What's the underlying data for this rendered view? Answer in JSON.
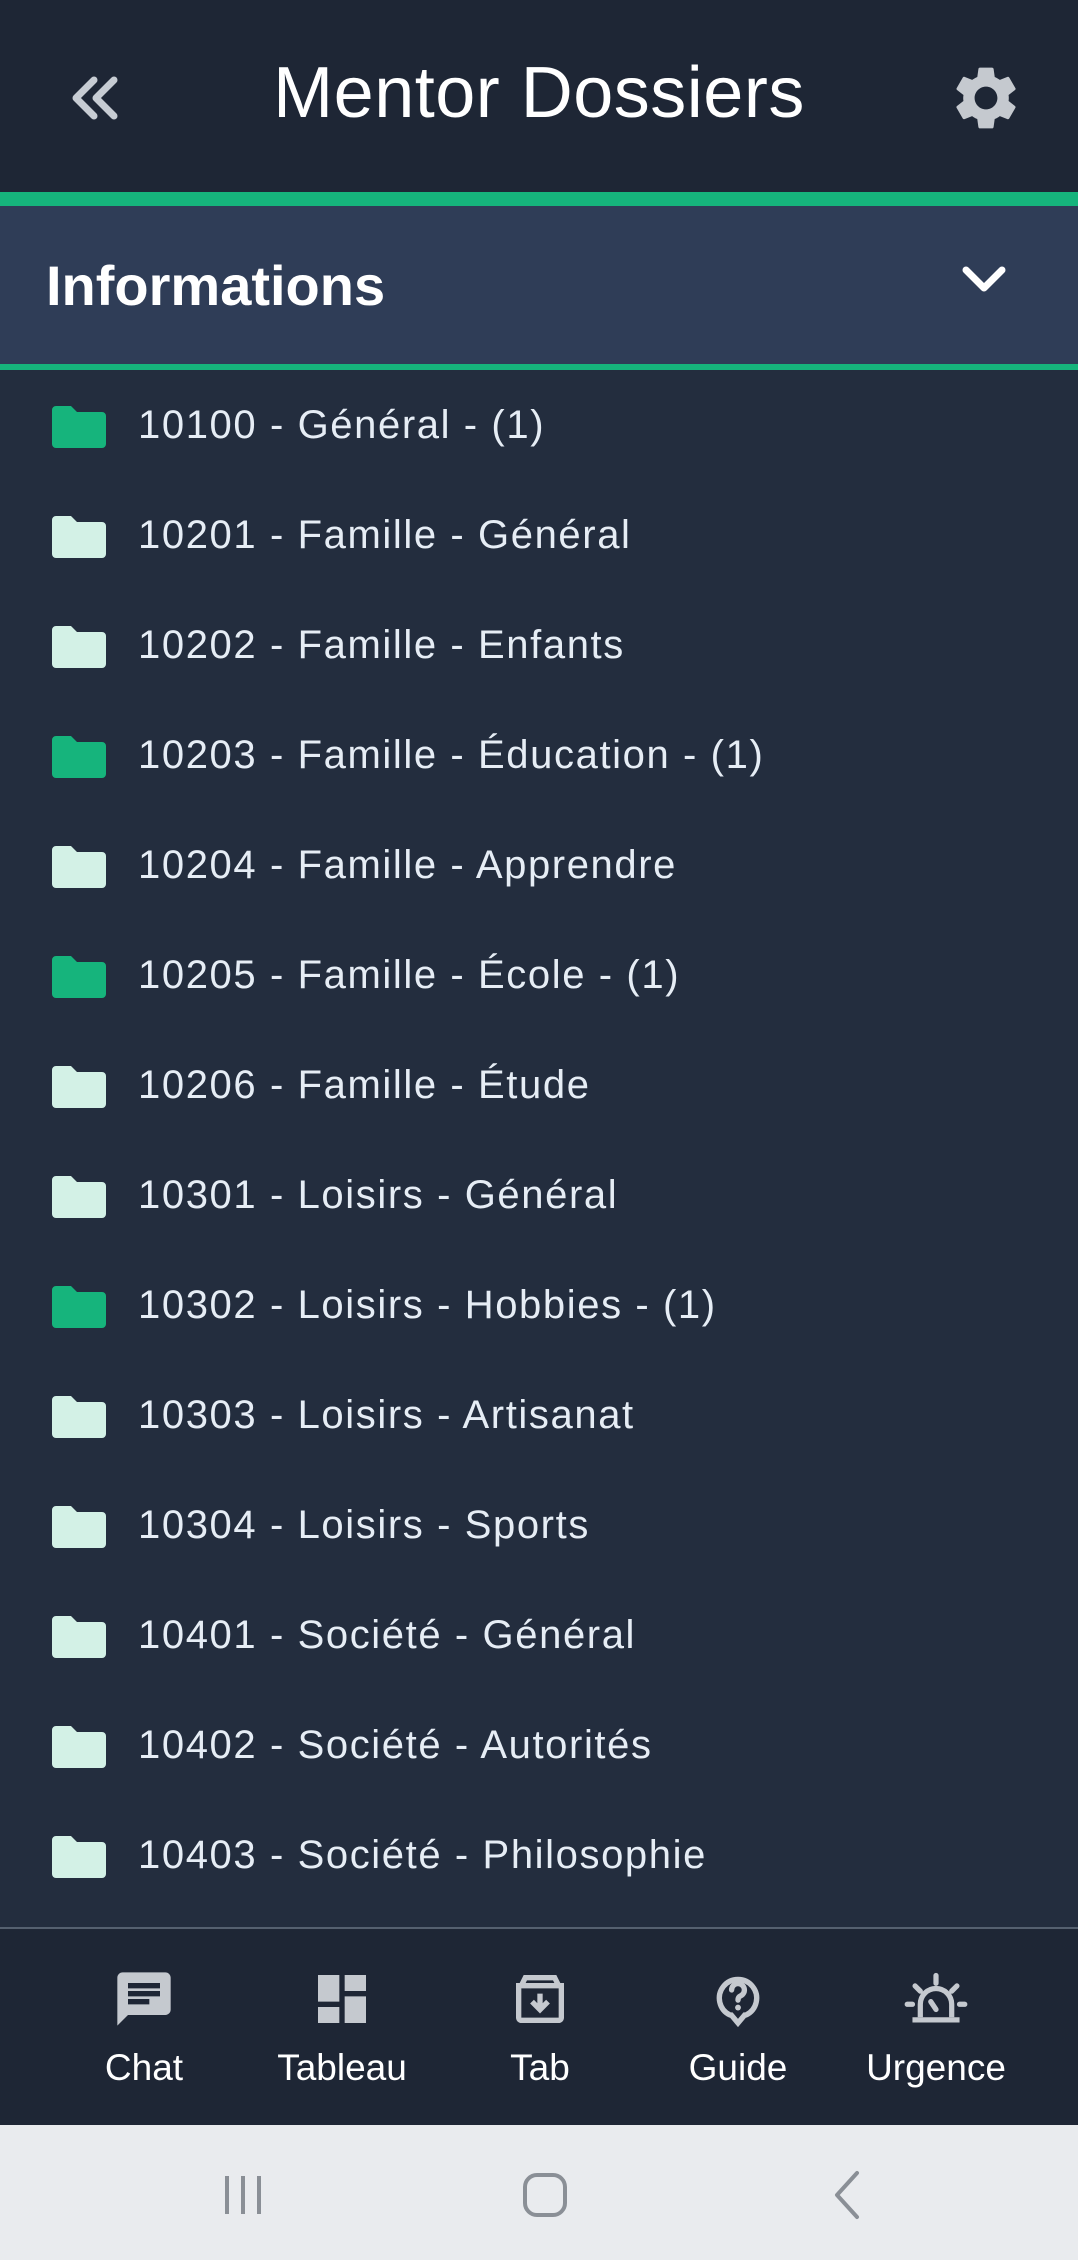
{
  "header": {
    "title": "Mentor Dossiers",
    "back_icon": "double-chevron-left-icon",
    "settings_icon": "gear-icon"
  },
  "section": {
    "title": "Informations",
    "toggle_icon": "chevron-down-icon",
    "expanded": true
  },
  "folders": [
    {
      "label": "10100 - Général - (1)",
      "has_items": true
    },
    {
      "label": "10201 - Famille - Général",
      "has_items": false
    },
    {
      "label": "10202 - Famille - Enfants",
      "has_items": false
    },
    {
      "label": "10203 - Famille - Éducation - (1)",
      "has_items": true
    },
    {
      "label": "10204 - Famille - Apprendre",
      "has_items": false
    },
    {
      "label": "10205 - Famille - École - (1)",
      "has_items": true
    },
    {
      "label": "10206 - Famille - Étude",
      "has_items": false
    },
    {
      "label": "10301 - Loisirs - Général",
      "has_items": false
    },
    {
      "label": "10302 - Loisirs - Hobbies - (1)",
      "has_items": true
    },
    {
      "label": "10303 - Loisirs - Artisanat",
      "has_items": false
    },
    {
      "label": "10304 - Loisirs - Sports",
      "has_items": false
    },
    {
      "label": "10401 - Société - Général",
      "has_items": false
    },
    {
      "label": "10402 - Société - Autorités",
      "has_items": false
    },
    {
      "label": "10403 - Société - Philosophie",
      "has_items": false
    }
  ],
  "tabs": [
    {
      "label": "Chat",
      "icon": "chat-icon"
    },
    {
      "label": "Tableau",
      "icon": "dashboard-icon"
    },
    {
      "label": "Tab",
      "icon": "archive-icon"
    },
    {
      "label": "Guide",
      "icon": "help-icon"
    },
    {
      "label": "Urgence",
      "icon": "alarm-icon"
    }
  ],
  "system_nav": {
    "recents_icon": "recents-icon",
    "home_icon": "home-icon",
    "back_icon": "back-icon"
  },
  "colors": {
    "accent": "#16b47c",
    "folder_filled": "#16b47c",
    "folder_empty": "#d3f1e6",
    "background": "#232d3e",
    "header": "#1e2635",
    "section": "#2f3d57"
  }
}
